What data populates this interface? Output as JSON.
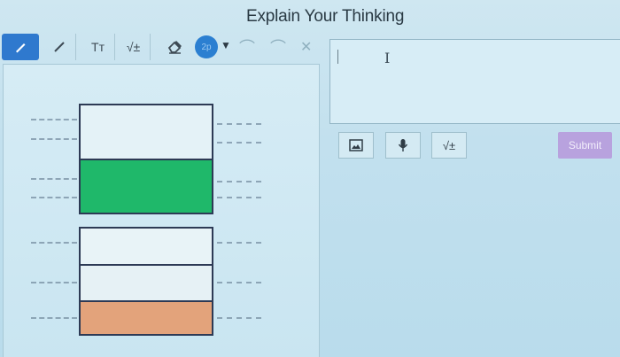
{
  "header": {
    "title": "Explain Your Thinking"
  },
  "toolbar": {
    "text_tool_label": "Tт",
    "math_tool_label": "√±",
    "color_label": "2p"
  },
  "response": {
    "math_label": "√±",
    "submit_label": "Submit"
  },
  "colors": {
    "accent": "#2f79ce",
    "green_fill": "#1fb86a",
    "orange_fill": "#e3a37b",
    "submit_disabled": "#b8a2de"
  },
  "drawing": {
    "bar_top_parts": 2,
    "bar_top_shaded_parts": 1,
    "bar_bottom_parts": 3,
    "bar_bottom_shaded_parts": 1
  }
}
